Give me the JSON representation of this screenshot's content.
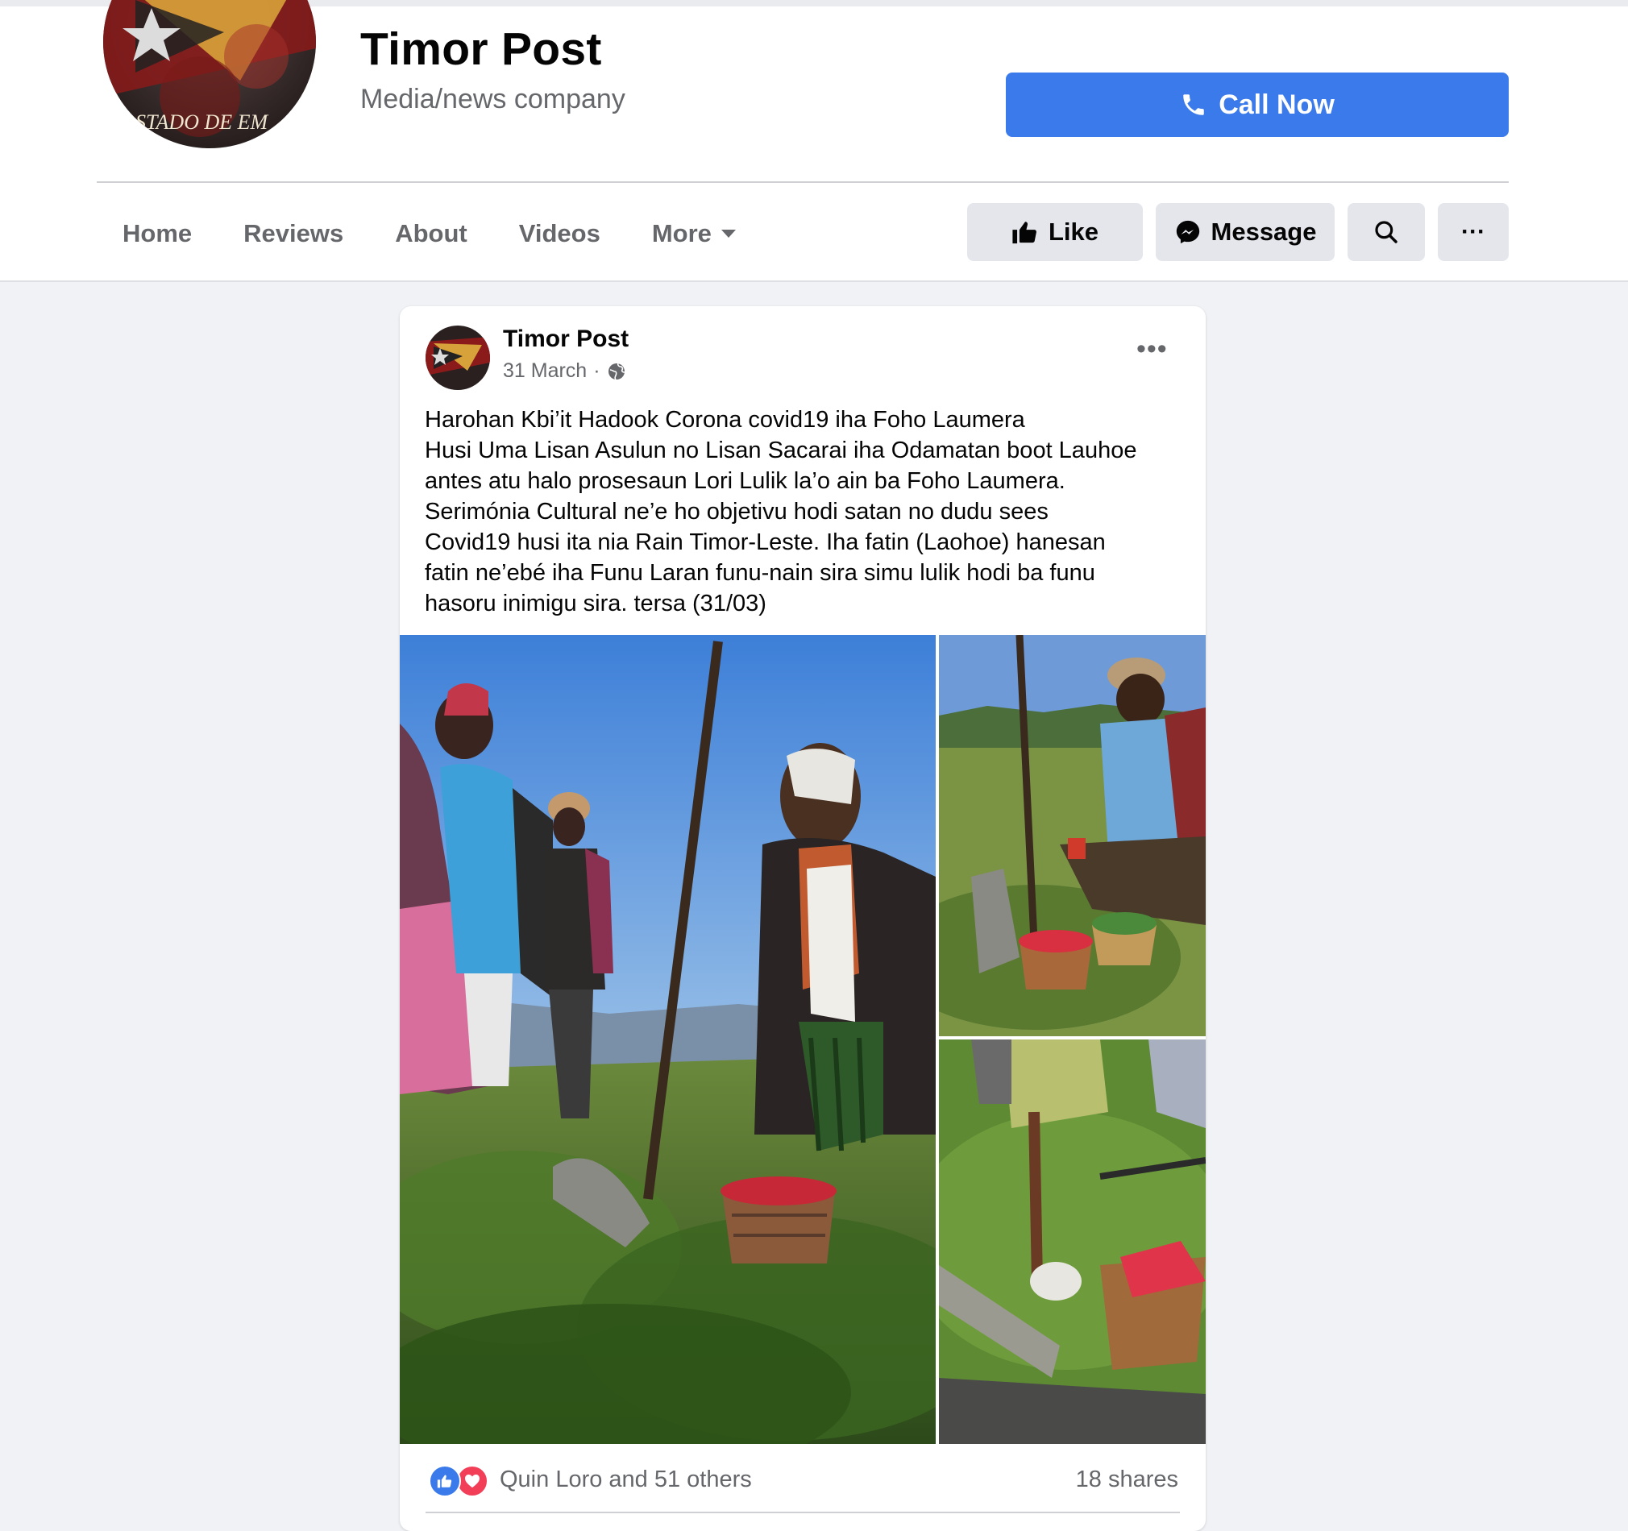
{
  "page": {
    "name": "Timor Post",
    "category": "Media/news company",
    "logo_text": "STADO DE EM",
    "call_label": "Call Now"
  },
  "nav": {
    "tabs": [
      "Home",
      "Reviews",
      "About",
      "Videos"
    ],
    "more_label": "More"
  },
  "actions": {
    "like_label": "Like",
    "message_label": "Message",
    "more_glyph": "···"
  },
  "post": {
    "author": "Timor Post",
    "date": "31 March",
    "separator": "·",
    "privacy_icon": "globe-icon",
    "more_glyph": "•••",
    "text_lines": [
      "Harohan Kbi’it Hadook Corona covid19 iha Foho Laumera",
      "Husi Uma Lisan Asulun no Lisan Sacarai iha Odamatan boot Lauhoe",
      "antes atu halo prosesaun Lori Lulik la’o ain ba Foho Laumera.",
      "Serimónia Cultural ne’e ho objetivu hodi satan no dudu sees",
      "Covid19 husi ita nia Rain Timor-Leste. Iha fatin (Laohoe) hanesan",
      "fatin ne’ebé iha Funu Laran  funu-nain sira simu lulik hodi ba funu",
      "hasoru inimigu sira. tersa (31/03)"
    ],
    "photos": [
      "photo-ceremony-main",
      "photo-man-kneeling",
      "photo-hands-basket"
    ],
    "reactions_text": "Quin Loro and 51 others",
    "shares_text": "18 shares",
    "reaction_icons": [
      "like-reaction-icon",
      "love-reaction-icon"
    ]
  },
  "colors": {
    "primary": "#3b7aea",
    "background": "#f0f2f5",
    "secondary_text": "#65676b",
    "button_gray": "#e4e6eb",
    "love": "#f33e58"
  }
}
